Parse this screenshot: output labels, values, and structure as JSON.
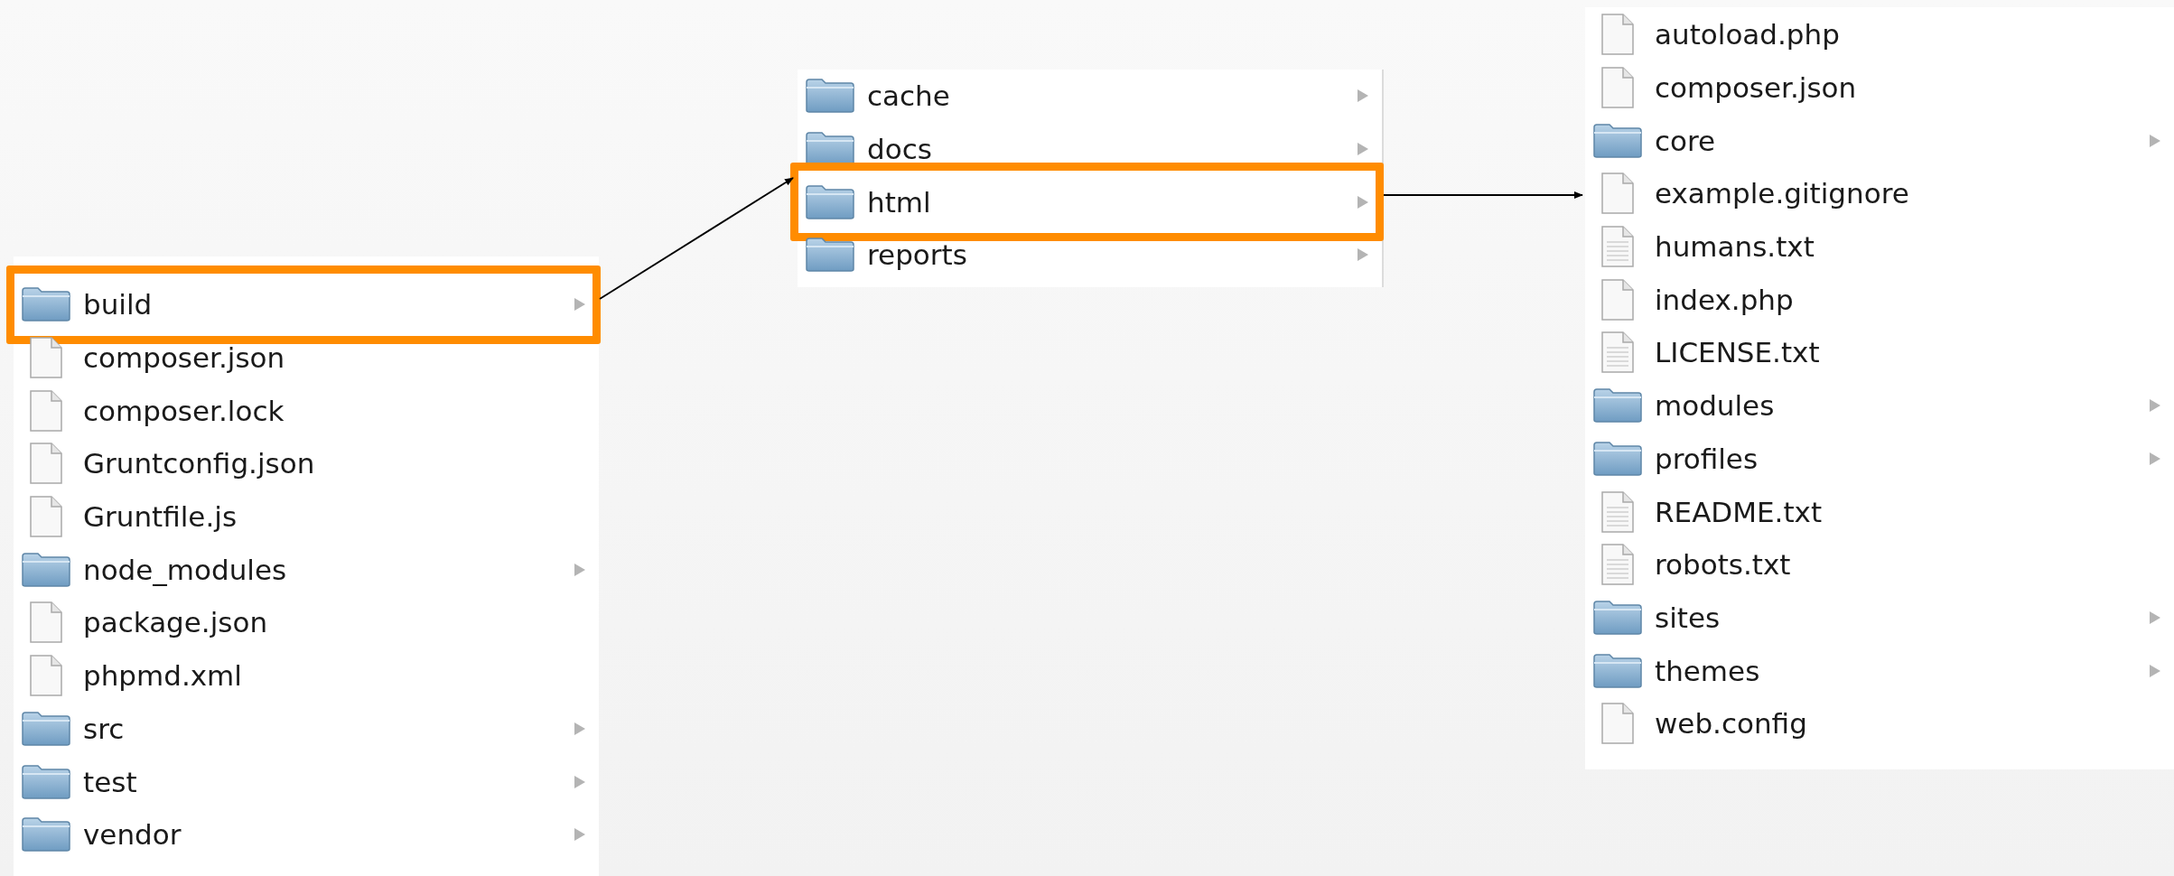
{
  "columns": [
    {
      "items": [
        {
          "name": "build",
          "kind": "folder",
          "selected": true
        },
        {
          "name": "composer.json",
          "kind": "file",
          "selected": false
        },
        {
          "name": "composer.lock",
          "kind": "file",
          "selected": false
        },
        {
          "name": "Gruntconfig.json",
          "kind": "file",
          "selected": false
        },
        {
          "name": "Gruntfile.js",
          "kind": "file",
          "selected": false
        },
        {
          "name": "node_modules",
          "kind": "folder",
          "selected": false
        },
        {
          "name": "package.json",
          "kind": "file",
          "selected": false
        },
        {
          "name": "phpmd.xml",
          "kind": "file",
          "selected": false
        },
        {
          "name": "src",
          "kind": "folder",
          "selected": false
        },
        {
          "name": "test",
          "kind": "folder",
          "selected": false
        },
        {
          "name": "vendor",
          "kind": "folder",
          "selected": false
        }
      ]
    },
    {
      "items": [
        {
          "name": "cache",
          "kind": "folder",
          "selected": false
        },
        {
          "name": "docs",
          "kind": "folder",
          "selected": false
        },
        {
          "name": "html",
          "kind": "folder",
          "selected": true
        },
        {
          "name": "reports",
          "kind": "folder",
          "selected": false
        }
      ]
    },
    {
      "items": [
        {
          "name": "autoload.php",
          "kind": "file",
          "selected": false
        },
        {
          "name": "composer.json",
          "kind": "file",
          "selected": false
        },
        {
          "name": "core",
          "kind": "folder",
          "selected": false
        },
        {
          "name": "example.gitignore",
          "kind": "file",
          "selected": false
        },
        {
          "name": "humans.txt",
          "kind": "text",
          "selected": false
        },
        {
          "name": "index.php",
          "kind": "file",
          "selected": false
        },
        {
          "name": "LICENSE.txt",
          "kind": "text",
          "selected": false
        },
        {
          "name": "modules",
          "kind": "folder",
          "selected": false
        },
        {
          "name": "profiles",
          "kind": "folder",
          "selected": false
        },
        {
          "name": "README.txt",
          "kind": "text",
          "selected": false
        },
        {
          "name": "robots.txt",
          "kind": "text",
          "selected": false
        },
        {
          "name": "sites",
          "kind": "folder",
          "selected": false
        },
        {
          "name": "themes",
          "kind": "folder",
          "selected": false
        },
        {
          "name": "web.config",
          "kind": "file",
          "selected": false
        }
      ]
    }
  ]
}
